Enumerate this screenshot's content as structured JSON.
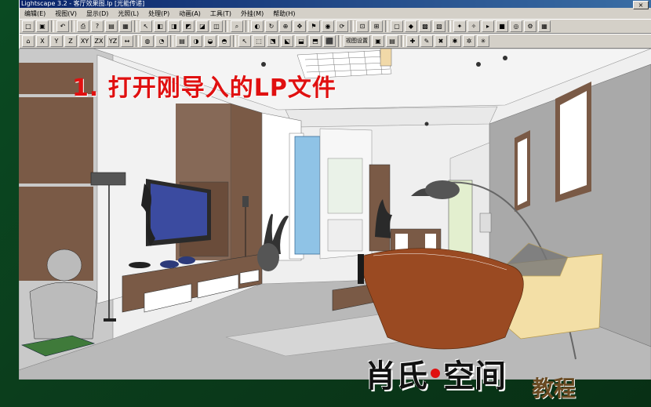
{
  "window": {
    "title": "Lightscape 3.2 - 客厅效果图.lp [光能传递]"
  },
  "menu": {
    "items": [
      "编辑(E)",
      "视图(V)",
      "显示(D)",
      "光照(L)",
      "处理(P)",
      "动画(A)",
      "工具(T)",
      "外挂(M)",
      "帮助(H)"
    ],
    "close_label": "×"
  },
  "toolbar2": {
    "axis_labels": [
      "X",
      "Y",
      "Z",
      "XY",
      "ZX",
      "YZ"
    ],
    "view_settings_label": "视图设置"
  },
  "overlay": {
    "caption": "1. 打开刚导入的LP文件",
    "brand_name_1": "肖氏",
    "brand_name_2": "空间",
    "brand_sub": "教程"
  },
  "colors": {
    "caption_red": "#e01010",
    "wall_wood": "#7a5a46",
    "tv_screen": "#3b4ba0",
    "glass_blue": "#8fc3e6",
    "chair_wood": "#9a4a22",
    "sofa_yellow": "#f3dfa6",
    "desktop_green": "#0b3d1c"
  }
}
